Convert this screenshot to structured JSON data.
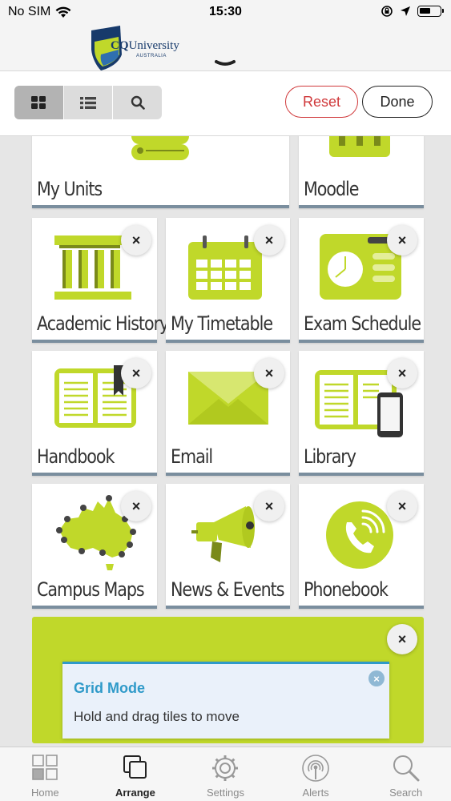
{
  "status_bar": {
    "carrier": "No SIM",
    "time": "15:30"
  },
  "logo": {
    "cq": "CQ",
    "university": "University",
    "subtitle": "AUSTRALIA"
  },
  "toolbar": {
    "view_modes": [
      "grid-icon",
      "list-icon",
      "search-icon"
    ],
    "active_view": "grid",
    "reset_label": "Reset",
    "done_label": "Done"
  },
  "tiles": [
    {
      "label": "My Units",
      "icon": "units-icon"
    },
    {
      "label": "Moodle",
      "icon": "moodle-icon"
    },
    {
      "label": "Academic History",
      "icon": "academic-history-icon"
    },
    {
      "label": "My Timetable",
      "icon": "timetable-icon"
    },
    {
      "label": "Exam Schedule",
      "icon": "exam-schedule-icon"
    },
    {
      "label": "Handbook",
      "icon": "handbook-icon"
    },
    {
      "label": "Email",
      "icon": "email-icon"
    },
    {
      "label": "Library",
      "icon": "library-icon"
    },
    {
      "label": "Campus Maps",
      "icon": "campus-maps-icon"
    },
    {
      "label": "News & Events",
      "icon": "news-events-icon"
    },
    {
      "label": "Phonebook",
      "icon": "phonebook-icon"
    }
  ],
  "close_glyph": "×",
  "tooltip": {
    "title": "Grid Mode",
    "body": "Hold and drag tiles to move",
    "close_glyph": "×"
  },
  "tabbar": {
    "items": [
      {
        "label": "Home",
        "icon": "home-grid-icon"
      },
      {
        "label": "Arrange",
        "icon": "arrange-icon"
      },
      {
        "label": "Settings",
        "icon": "gear-icon"
      },
      {
        "label": "Alerts",
        "icon": "alerts-icon"
      },
      {
        "label": "Search",
        "icon": "search-icon"
      }
    ],
    "active": "Arrange"
  },
  "colors": {
    "accent_green": "#c0d82a",
    "dark_green": "#7a8a1a",
    "reset_red": "#d0393b",
    "tooltip_blue": "#2f9ac9"
  }
}
